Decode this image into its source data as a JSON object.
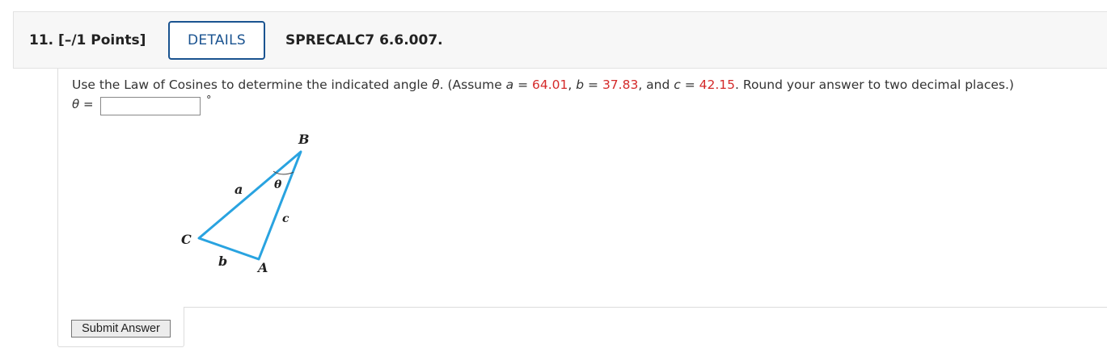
{
  "header": {
    "question_number": "11.",
    "points": "[–/1 Points]",
    "details_label": "DETAILS",
    "problem_code": "SPRECALC7 6.6.007."
  },
  "question": {
    "text_1": "Use the Law of Cosines to determine the indicated angle ",
    "theta_symbol": "θ",
    "text_2": ". (Assume ",
    "a_var": "a",
    "eq_1": " = ",
    "a_value": "64.01",
    "sep_1": ", ",
    "b_var": "b",
    "eq_2": " = ",
    "b_value": "37.83",
    "sep_2": ", and ",
    "c_var": "c",
    "eq_3": " = ",
    "c_value": "42.15",
    "text_3": ". Round your answer to two decimal places.)"
  },
  "answer": {
    "label": "θ =",
    "value": "",
    "unit": "°"
  },
  "figure": {
    "vertex_B": "B",
    "vertex_A": "A",
    "vertex_C": "C",
    "side_a": "a",
    "side_b": "b",
    "side_c": "c",
    "angle_label": "θ",
    "line_color": "#29a3e0"
  },
  "submit": {
    "label": "Submit Answer"
  }
}
